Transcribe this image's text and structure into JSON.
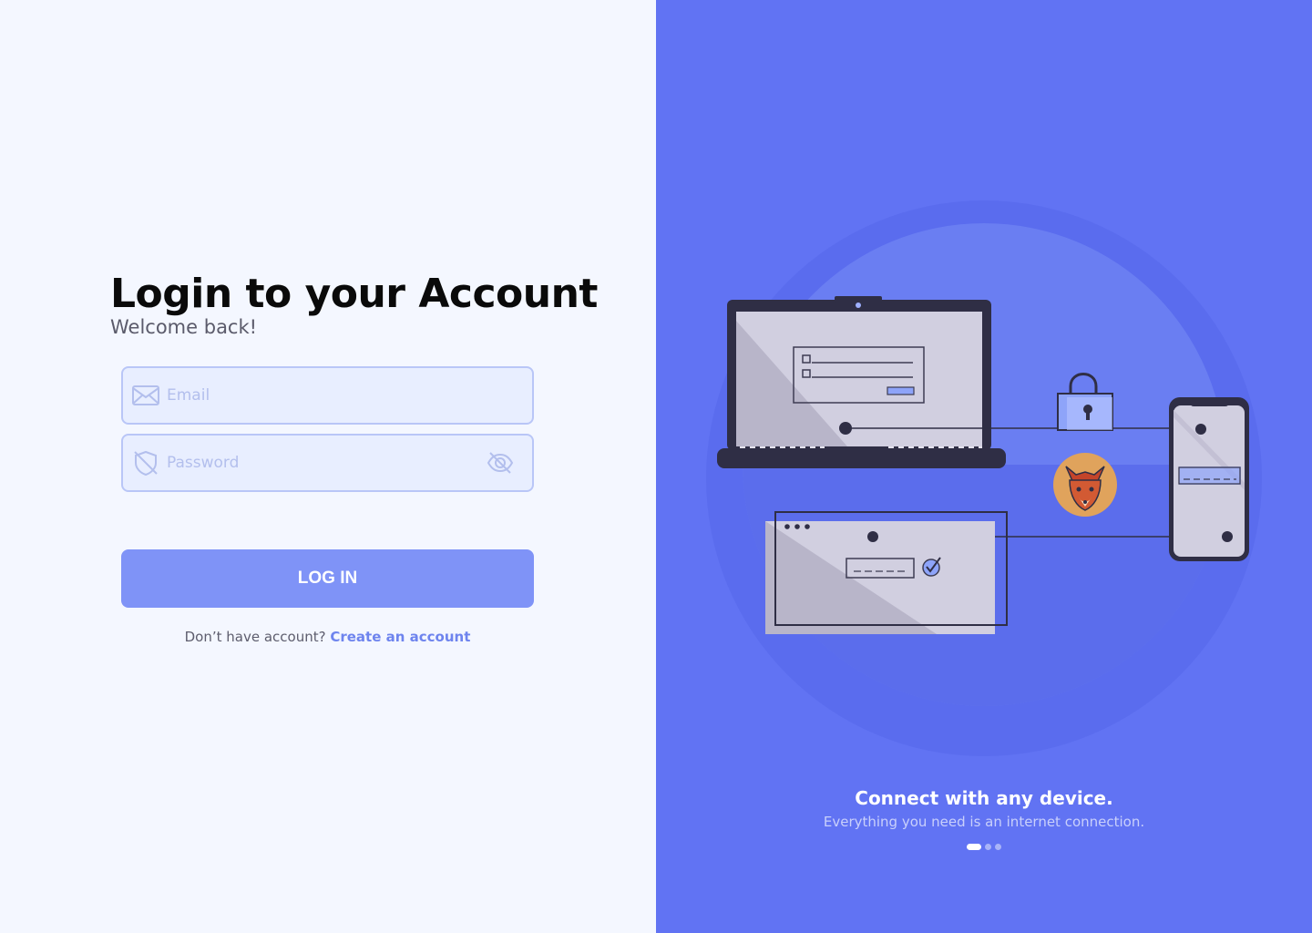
{
  "login": {
    "title": "Login to your Account",
    "subtitle": "Welcome back!",
    "email_placeholder": "Email",
    "password_placeholder": "Password",
    "login_button": "LOG IN",
    "no_account_text": "Don’t have account?",
    "create_account_link": "Create an account"
  },
  "promo": {
    "title": "Connect with any device.",
    "subtitle": "Everything you need is an internet connection.",
    "carousel_pages": 3,
    "active_page": 1
  },
  "colors": {
    "panel_bg": "#6173f3",
    "accent": "#7f93f7",
    "link": "#6e84ee",
    "page_bg": "#f4f7ff"
  },
  "icons": {
    "email": "envelope-icon",
    "password": "shield-icon",
    "toggle": "eye-off-icon",
    "badge": "fox-mascot-icon"
  }
}
